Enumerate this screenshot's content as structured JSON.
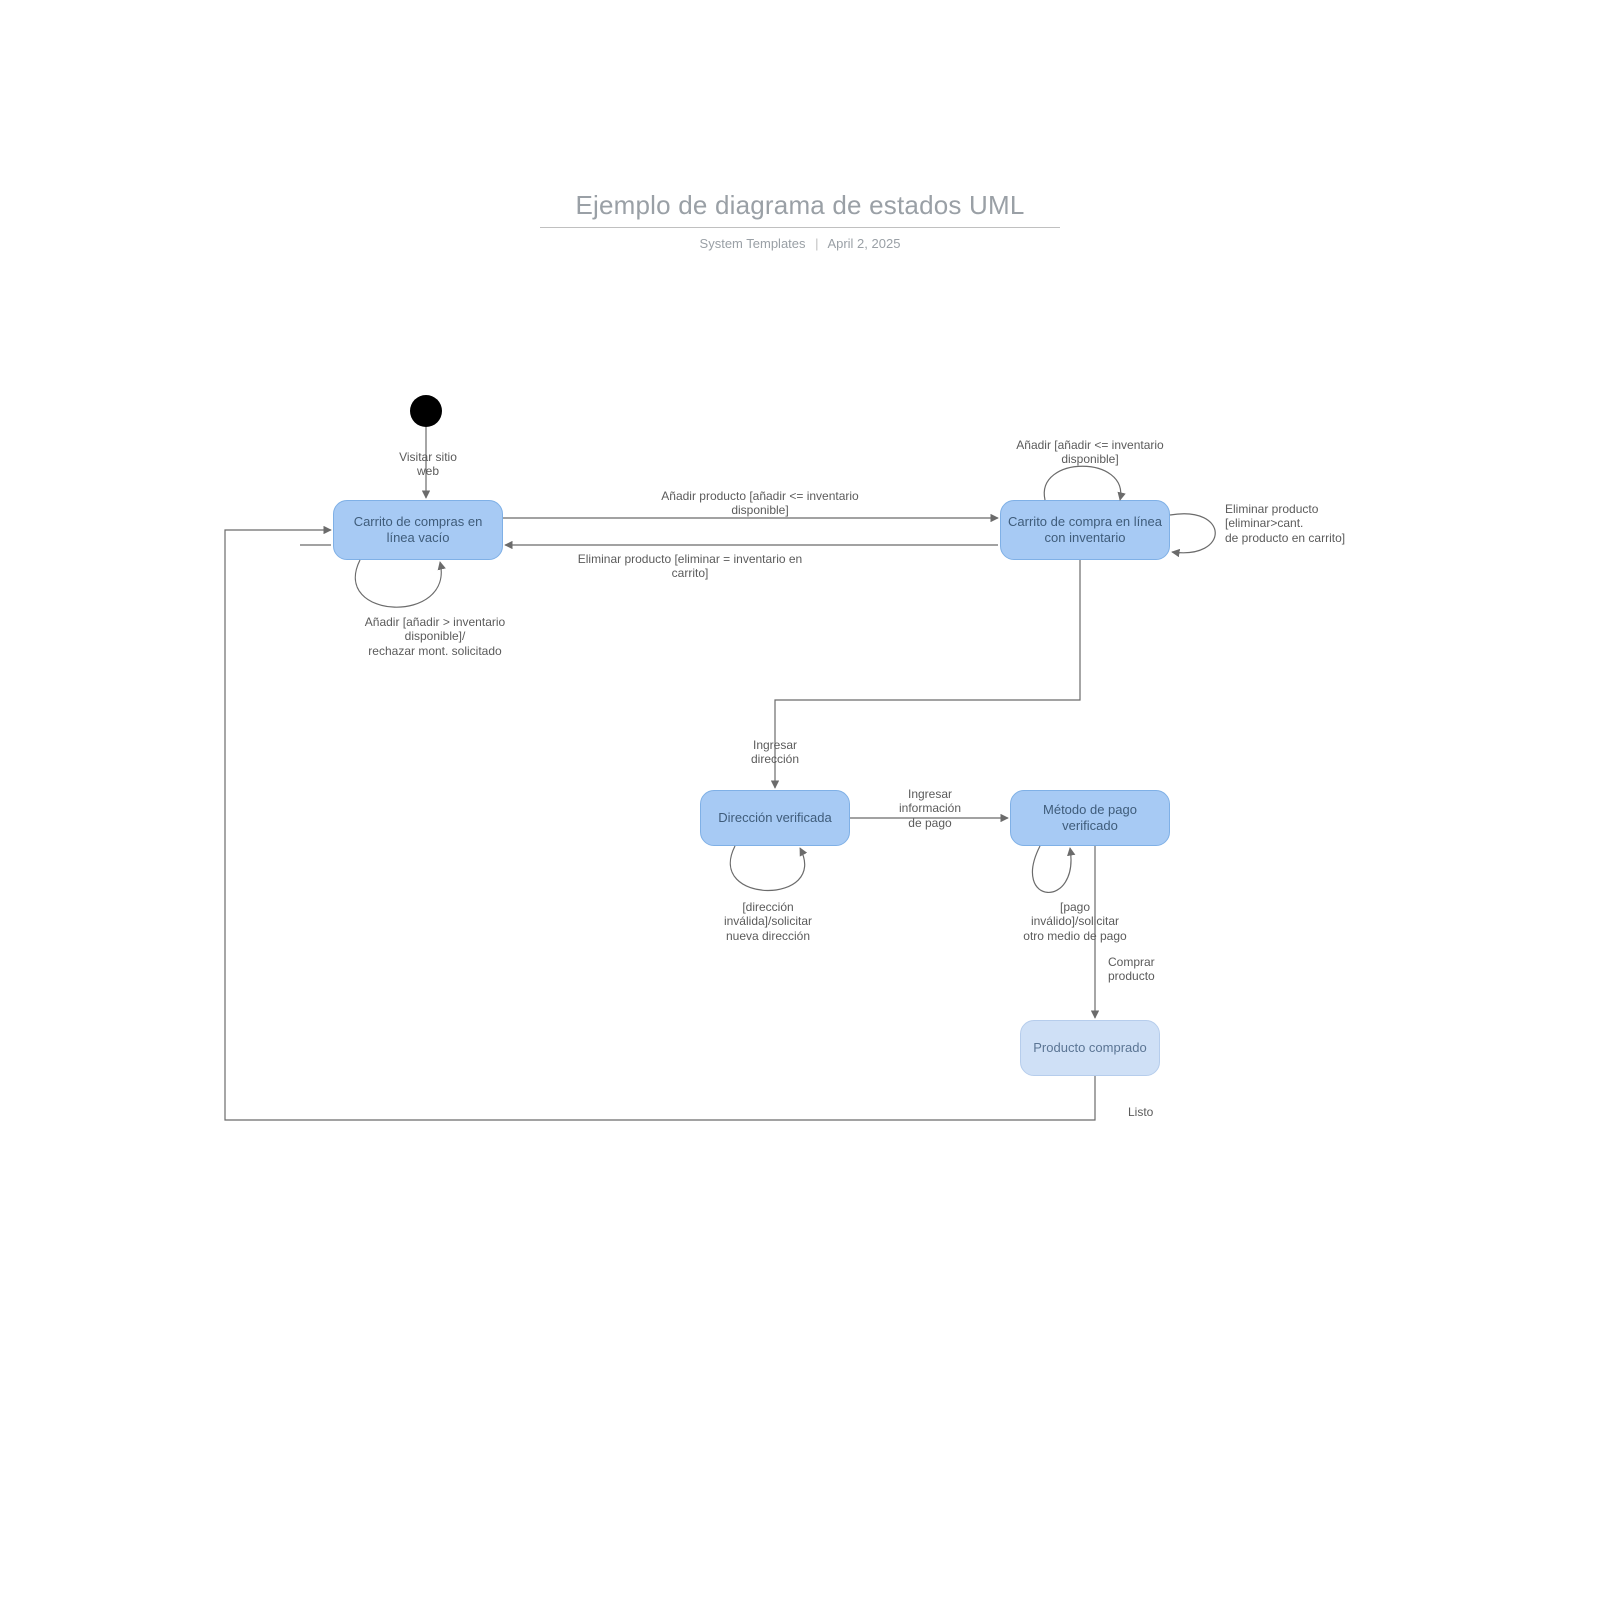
{
  "header": {
    "title": "Ejemplo de diagrama de estados UML",
    "source": "System Templates",
    "date": "April 2, 2025"
  },
  "states": {
    "empty_cart": "Carrito de\ncompras en línea\nvacío",
    "cart_inv": "Carrito de compra\nen línea con\ninventario",
    "addr_verified": "Dirección\nverificada",
    "pay_verified": "Método de pago\nverificado",
    "purchased": "Producto\ncomprado"
  },
  "transitions": {
    "visit": "Visitar sitio\nweb",
    "add_to_inv": "Añadir producto [añadir <= inventario\ndisponible]",
    "remove_all": "Eliminar producto [eliminar = inventario en\ncarrito]",
    "add_self": "Añadir [añadir <= inventario\ndisponible]",
    "remove_self": "Eliminar producto\n[eliminar>cant.\nde producto en carrito]",
    "add_reject": "Añadir [añadir > inventario\ndisponible]/\nrechazar mont. solicitado",
    "enter_addr": "Ingresar\ndirección",
    "addr_invalid": "[dirección\ninválida]/solicitar\nnueva dirección",
    "enter_pay": "Ingresar\ninformación\nde pago",
    "pay_invalid": "[pago\ninválido]/solicitar\notro medio de pago",
    "buy": "Comprar\nproducto",
    "done": "Listo"
  },
  "colors": {
    "state_fill": "#a7caf4",
    "state_light_fill": "#cfe0f6",
    "edge": "#6b6b6b"
  }
}
